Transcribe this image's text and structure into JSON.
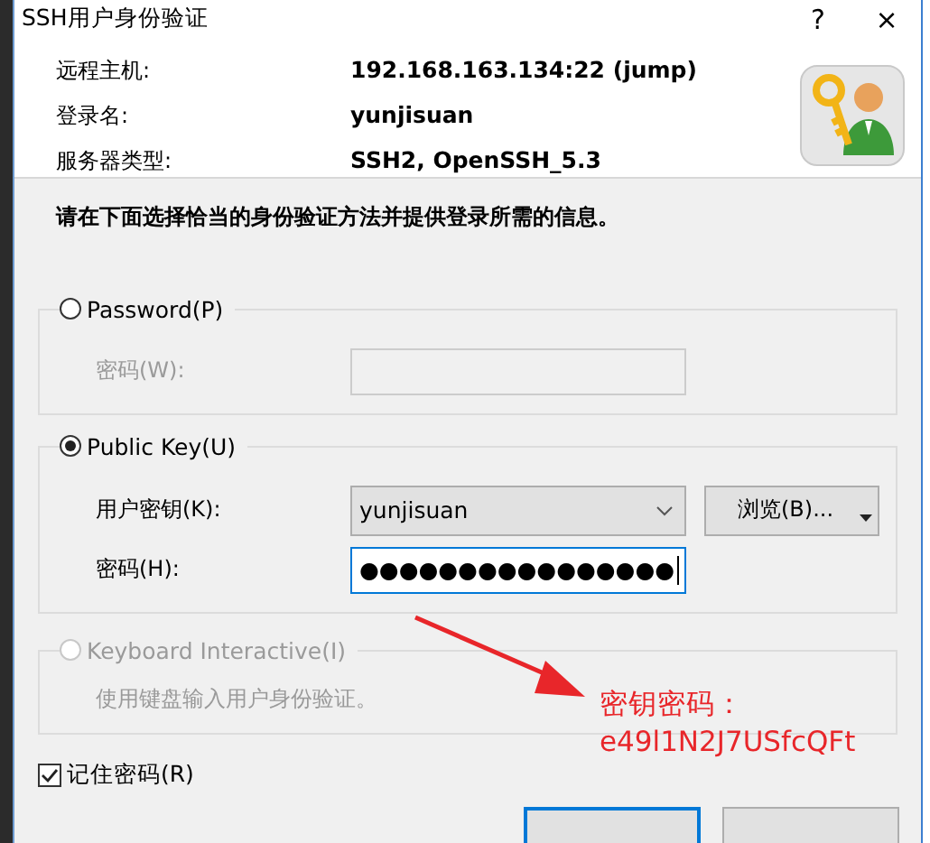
{
  "window": {
    "title": "SSH用户身份验证",
    "buttons": [
      "?",
      "×"
    ]
  },
  "header": {
    "fields": [
      {
        "label": "远程主机:",
        "value": "192.168.163.134:22 (jump)"
      },
      {
        "label": "登录名:",
        "value": "yunjisuan"
      },
      {
        "label": "服务器类型:",
        "value": "SSH2, OpenSSH_5.3"
      }
    ]
  },
  "instruction": "请在下面选择恰当的身份验证方法并提供登录所需的信息。",
  "methods": [
    {
      "kind": "password",
      "label": "Password(P)",
      "selected": false,
      "disabled": false,
      "fields": [
        {
          "kind": "text",
          "label": "密码(W):",
          "disabled": true
        }
      ]
    },
    {
      "kind": "publickey",
      "label": "Public Key(U)",
      "selected": true,
      "disabled": false,
      "fields": [
        {
          "kind": "combo",
          "label": "用户密钥(K):",
          "value": "yunjisuan",
          "button": "浏览(B)...",
          "disabled": false
        },
        {
          "kind": "text",
          "label": "密码(H):",
          "value": "●●●●●●●●●●●●●●●●",
          "disabled": false
        }
      ]
    },
    {
      "kind": "keyboard",
      "label": "Keyboard Interactive(I)",
      "selected": false,
      "disabled": true,
      "description": "使用键盘输入用户身份验证。"
    }
  ],
  "remember": {
    "label": "记住密码(R)",
    "checked": true
  },
  "annotation": {
    "lines": [
      "密钥密码：",
      "e49l1N2J7USfcQFt"
    ]
  }
}
